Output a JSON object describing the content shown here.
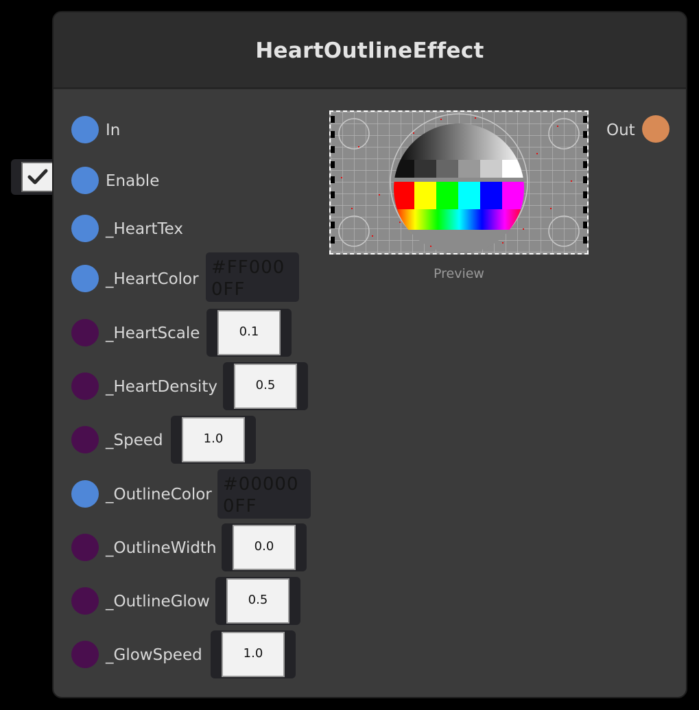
{
  "node": {
    "title": "HeartOutlineEffect",
    "preview_label": "Preview",
    "output": {
      "label": "Out",
      "port_color": "#d88a55"
    },
    "enable_checked": true,
    "inputs": [
      {
        "label": "In",
        "port": "blue"
      },
      {
        "label": "Enable",
        "port": "blue"
      },
      {
        "label": "_HeartTex",
        "port": "blue"
      },
      {
        "label": "_HeartColor",
        "port": "blue",
        "value": "#FF0000FF"
      },
      {
        "label": "_HeartScale",
        "port": "purple",
        "value": "0.1"
      },
      {
        "label": "_HeartDensity",
        "port": "purple",
        "value": "0.5"
      },
      {
        "label": "_Speed",
        "port": "purple",
        "value": "1.0"
      },
      {
        "label": "_OutlineColor",
        "port": "blue",
        "value": "#000000FF"
      },
      {
        "label": "_OutlineWidth",
        "port": "purple",
        "value": "0.0"
      },
      {
        "label": "_OutlineGlow",
        "port": "purple",
        "value": "0.5"
      },
      {
        "label": "_GlowSpeed",
        "port": "purple",
        "value": "1.0"
      }
    ]
  },
  "colors": {
    "port_blue": "#4f87d8",
    "port_purple": "#4a0e4e",
    "port_orange": "#d88a55",
    "node_bg": "#3b3b3b",
    "header_bg": "#2d2d2d"
  }
}
